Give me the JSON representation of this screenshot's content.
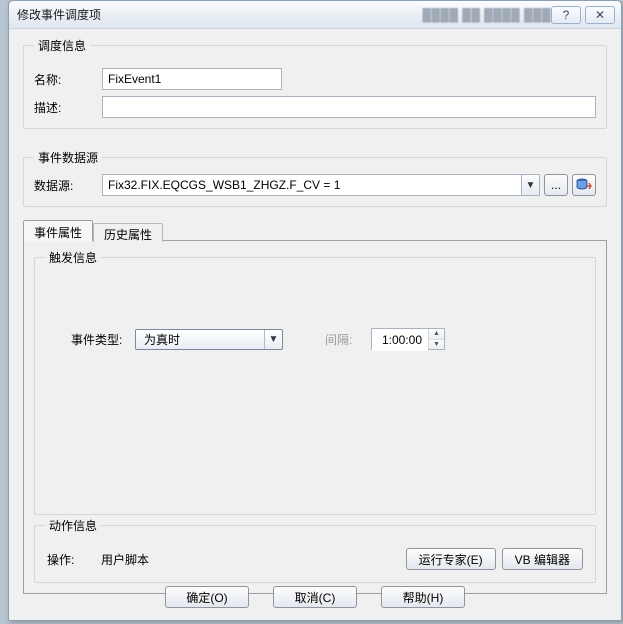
{
  "title": "修改事件调度项",
  "titlebar_blur": "████  ██  ████  ███",
  "winbuttons": {
    "help_glyph": "?",
    "close_glyph": "✕"
  },
  "sched": {
    "legend": "调度信息",
    "name_label": "名称:",
    "name_value": "FixEvent1",
    "desc_label": "描述:",
    "desc_value": ""
  },
  "source": {
    "legend": "事件数据源",
    "label": "数据源:",
    "value": "Fix32.FIX.EQCGS_WSB1_ZHGZ.F_CV = 1",
    "ellipsis": "...",
    "db_icon_name": "database-icon"
  },
  "tabs": {
    "event": "事件属性",
    "history": "历史属性"
  },
  "fire": {
    "legend": "触发信息",
    "event_type_label": "事件类型:",
    "event_type_value": "为真时",
    "interval_label": "间隔:",
    "interval_value": "1:00:00"
  },
  "action": {
    "legend": "动作信息",
    "op_label": "操作:",
    "op_value": "用户脚本",
    "run_expert": "运行专家(E)",
    "vb_editor": "VB 编辑器"
  },
  "dialog_buttons": {
    "ok": "确定(O)",
    "cancel": "取消(C)",
    "help": "帮助(H)"
  }
}
